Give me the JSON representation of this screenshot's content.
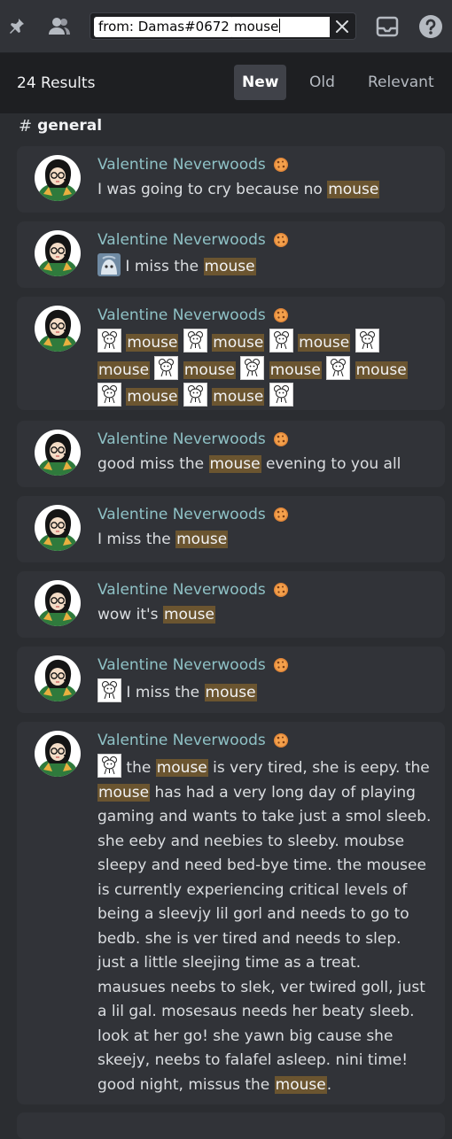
{
  "toolbar": {
    "pin_icon": "pin-icon",
    "members_icon": "members-icon",
    "inbox_icon": "inbox-icon",
    "help_icon": "help-icon"
  },
  "search": {
    "filter_chip": "from: Damas#0672",
    "query": "mouse",
    "clear_icon": "close-icon"
  },
  "results": {
    "count_label": "24 Results",
    "sort_options": [
      "New",
      "Old",
      "Relevant"
    ],
    "active_sort": "New",
    "channel": "general"
  },
  "author_name": "Valentine Neverwoods",
  "colors": {
    "highlight": "#6b5530",
    "author": "#8fc2c6",
    "card": "#313338",
    "header": "#1e1f22"
  },
  "messages": [
    {
      "parts": [
        "I was going to cry because no ",
        "mouse"
      ]
    },
    {
      "parts": [
        " I miss the ",
        "mouse"
      ]
    },
    {
      "parts": [
        "mouse",
        "mouse",
        "mouse",
        "mouse",
        "mouse",
        "mouse",
        "mouse",
        "mouse",
        "mouse"
      ]
    },
    {
      "parts": [
        "good miss the ",
        "mouse",
        " evening to you all"
      ]
    },
    {
      "parts": [
        "I miss the ",
        "mouse"
      ]
    },
    {
      "parts": [
        "wow it's ",
        "mouse"
      ]
    },
    {
      "parts": [
        " I miss the ",
        "mouse"
      ]
    },
    {
      "parts": [
        " the ",
        "mouse",
        " is very tired, she is eepy. the ",
        "mouse",
        " has had a very long day of playing gaming and wants to take just a smol sleeb. she eeby and neebies to sleeby. moubse sleepy and need bed-bye time. the mousee is currently experiencing critical levels of being a sleevjy lil gorl and needs to go to bedb. she is ver tired and needs to slep. just a little sleejing time as a treat. mausues neebs to slek, ver twired goll, just a lil gal. mosesaus needs her beaty sleeb. look at her go! she yawn big cause she skeejy, neebs to falafel asleep. nini time! good night, missus the ",
        "mouse",
        "."
      ]
    }
  ]
}
